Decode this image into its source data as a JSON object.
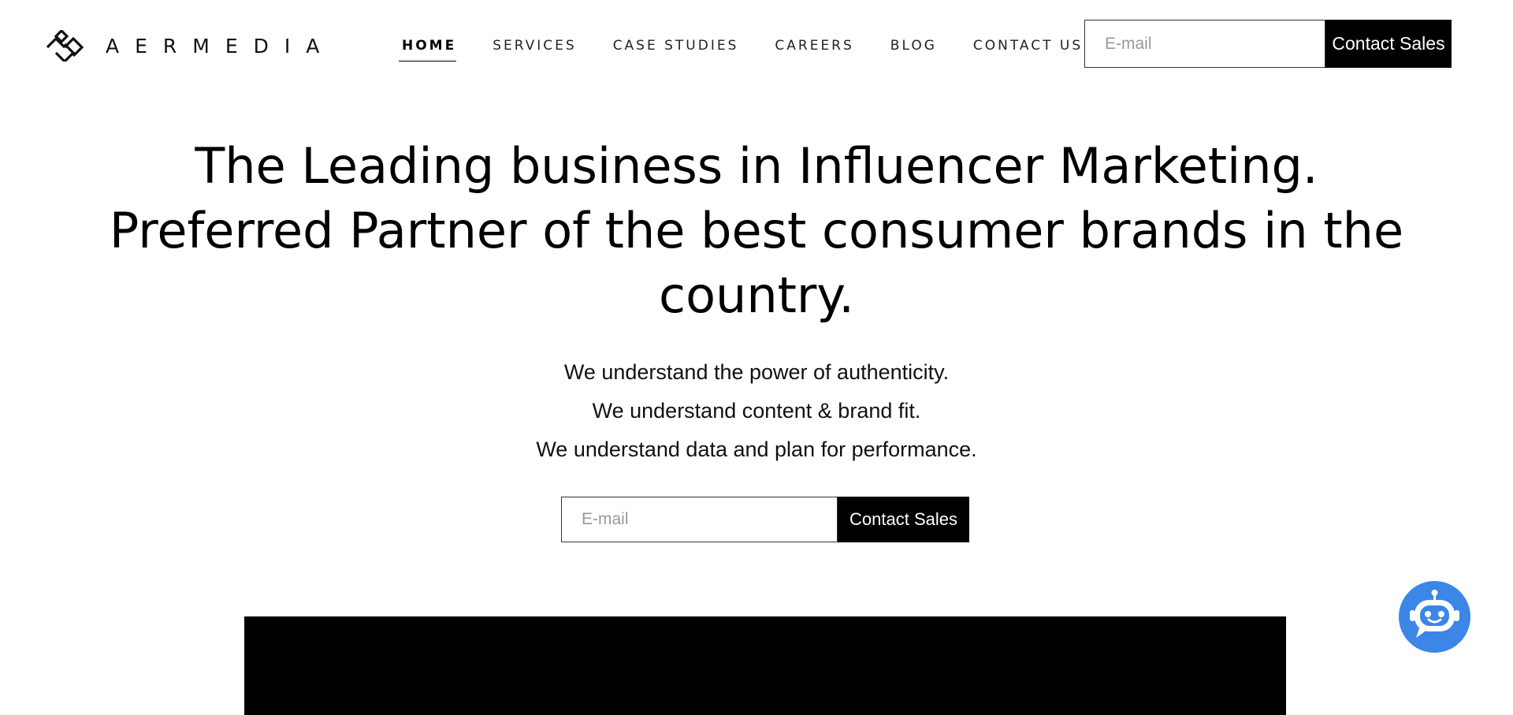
{
  "brand": {
    "name": "AERMEDIA",
    "logo_icon": "aermedia-diamond-logo-icon"
  },
  "nav": {
    "items": [
      {
        "label": "HOME",
        "active": true
      },
      {
        "label": "SERVICES",
        "active": false
      },
      {
        "label": "CASE STUDIES",
        "active": false
      },
      {
        "label": "CAREERS",
        "active": false
      },
      {
        "label": "BLOG",
        "active": false
      },
      {
        "label": "CONTACT US",
        "active": false
      }
    ]
  },
  "header_form": {
    "email_placeholder": "E-mail",
    "button_label": "Contact Sales"
  },
  "hero": {
    "title_lines": [
      "The Leading business in Influencer Marketing.",
      "Preferred Partner of the best consumer brands in the",
      "country."
    ],
    "taglines": [
      "We understand the power of authenticity.",
      "We understand content & brand fit.",
      "We understand data and plan for performance."
    ]
  },
  "hero_form": {
    "email_placeholder": "E-mail",
    "button_label": "Contact Sales"
  },
  "chat_widget": {
    "icon": "chat-bot-icon",
    "color": "#3b86e6"
  },
  "colors": {
    "background": "#ffffff",
    "text": "#000000",
    "button": "#000000",
    "chat_accent": "#3b86e6"
  }
}
